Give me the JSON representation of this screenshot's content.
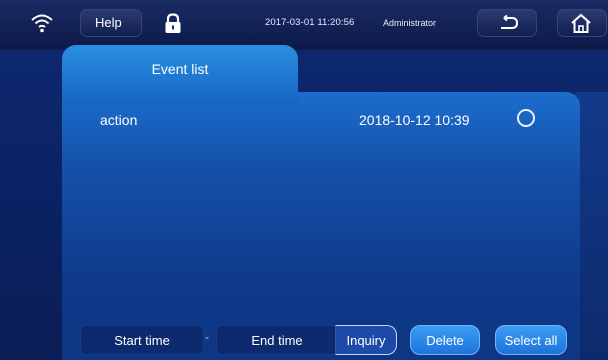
{
  "topbar": {
    "help_label": "Help",
    "datetime": "2017-03-01 11:20:56",
    "user": "Administrator",
    "icons": [
      "wifi-icon",
      "lock-icon",
      "back-icon",
      "home-icon"
    ]
  },
  "tab": {
    "label": "Event list"
  },
  "events": [
    {
      "title": "action",
      "time": "2018-10-12 10:39",
      "selected": false
    }
  ],
  "controls": {
    "start_time": "Start time",
    "separator": "-",
    "end_time": "End time",
    "inquiry": "Inquiry",
    "delete": "Delete",
    "select_all": "Select all"
  },
  "colors": {
    "panel_top": "#1c6dce",
    "panel_bottom": "#0e3682",
    "tab": "#2a8fe0",
    "button_blue": "#1e74db"
  }
}
